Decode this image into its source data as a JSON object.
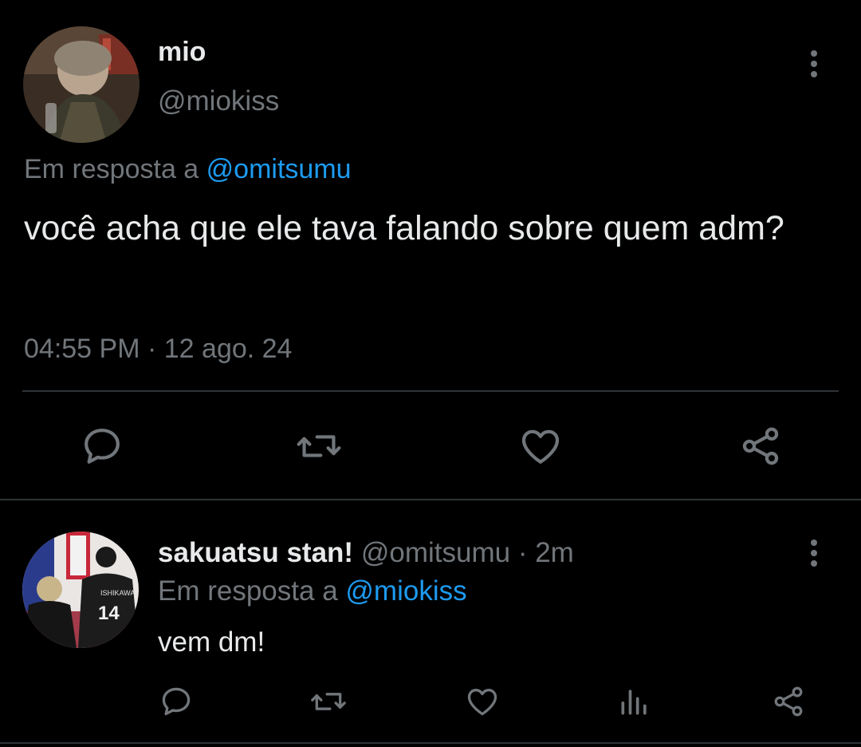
{
  "main_tweet": {
    "display_name": "mio",
    "handle": "@miokiss",
    "reply_prefix": "Em resposta a",
    "reply_target": "@omitsumu",
    "text": "você acha que ele tava falando sobre quem adm?",
    "time": "04:55 PM",
    "separator": "·",
    "date": "12 ago. 24",
    "actions": [
      "comment-icon",
      "retweet-icon",
      "like-icon",
      "share-icon"
    ]
  },
  "reply_tweet": {
    "display_name": "sakuatsu stan!",
    "handle": "@omitsumu",
    "separator": "·",
    "time_ago": "2m",
    "reply_prefix": "Em resposta a",
    "reply_target": "@miokiss",
    "text": "vem dm!",
    "avatar_jersey_name": "ISHIKAWA",
    "avatar_jersey_number": "14",
    "actions": [
      "comment-icon",
      "retweet-icon",
      "like-icon",
      "views-icon",
      "share-icon"
    ]
  },
  "colors": {
    "background": "#000000",
    "text": "#e7e9ea",
    "secondary": "#71767b",
    "link": "#1d9bf0",
    "divider": "#2f3336"
  }
}
